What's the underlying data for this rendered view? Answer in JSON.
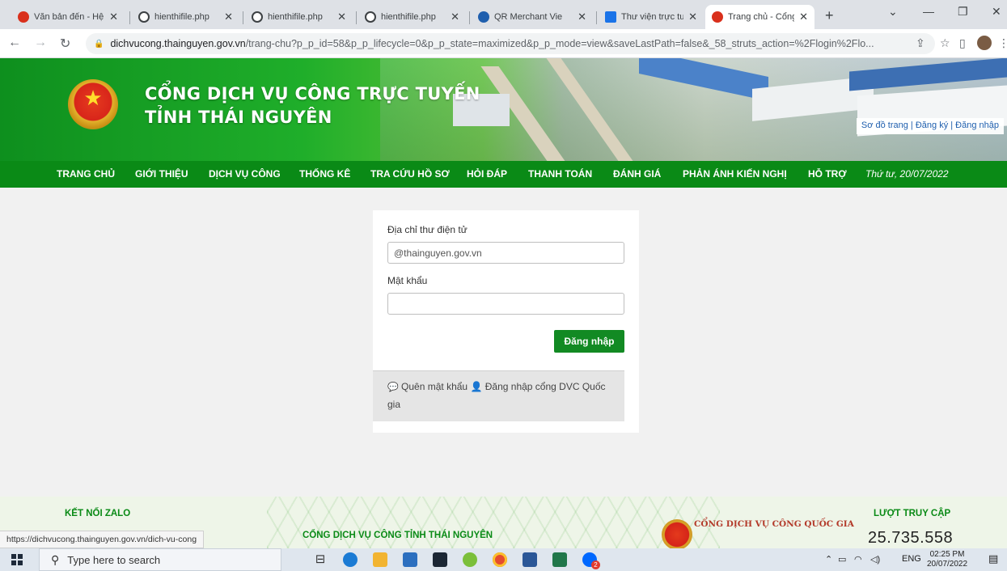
{
  "browser": {
    "tabs": [
      {
        "title": "Văn bản đến - Hệ",
        "favicon_color": "#d9301c"
      },
      {
        "title": "hienthifile.php",
        "favicon_color": "#3c4043"
      },
      {
        "title": "hienthifile.php",
        "favicon_color": "#3c4043"
      },
      {
        "title": "hienthifile.php",
        "favicon_color": "#3c4043"
      },
      {
        "title": "QR Merchant Vie",
        "favicon_color": "#1f5fae"
      },
      {
        "title": "Thư viện trực tuy",
        "favicon_color": "#1a73e8"
      },
      {
        "title": "Trang chủ - Cổng",
        "favicon_color": "#d9301c"
      }
    ],
    "new_tab": "+",
    "url_domain": "dichvucong.thainguyen.gov.vn",
    "url_path": "/trang-chu?p_p_id=58&p_p_lifecycle=0&p_p_state=maximized&p_p_mode=view&saveLastPath=false&_58_struts_action=%2Flogin%2Flo..."
  },
  "site": {
    "title_line1": "CỔNG DỊCH VỤ CÔNG TRỰC TUYẾN",
    "title_line2": "TỈNH THÁI NGUYÊN",
    "links": "Sơ đồ trang | Đăng ký | Đăng nhập",
    "nav": [
      "TRANG CHỦ",
      "GIỚI THIỆU",
      "DỊCH VỤ CÔNG",
      "THỐNG KÊ",
      "TRA CỨU HỒ SƠ",
      "HỎI ĐÁP",
      "THANH TOÁN",
      "ĐÁNH GIÁ",
      "PHẢN ÁNH KIẾN NGHỊ",
      "HỖ TRỢ"
    ],
    "date": "Thứ tư, 20/07/2022"
  },
  "login": {
    "email_label": "Địa chỉ thư điện tử",
    "email_value": "@thainguyen.gov.vn",
    "password_label": "Mật khẩu",
    "password_value": "",
    "submit": "Đăng nhập",
    "forgot": "Quên mật khẩu",
    "national_login": "Đăng nhập cổng DVC Quốc gia"
  },
  "footer": {
    "zalo": "KẾT NỐI ZALO",
    "portal_name": "CỔNG DỊCH VỤ CÔNG TỈNH THÁI NGUYÊN",
    "national_portal": "CỔNG DỊCH VỤ CÔNG QUỐC GIA",
    "visit_label": "LƯỢT TRUY CẬP",
    "visit_count": "25.735.558"
  },
  "status_url": "https://dichvucong.thainguyen.gov.vn/dich-vu-cong",
  "taskbar": {
    "search_placeholder": "Type here to search",
    "lang": "ENG",
    "time": "02:25 PM",
    "date": "20/07/2022",
    "zalo_badge": "2"
  }
}
